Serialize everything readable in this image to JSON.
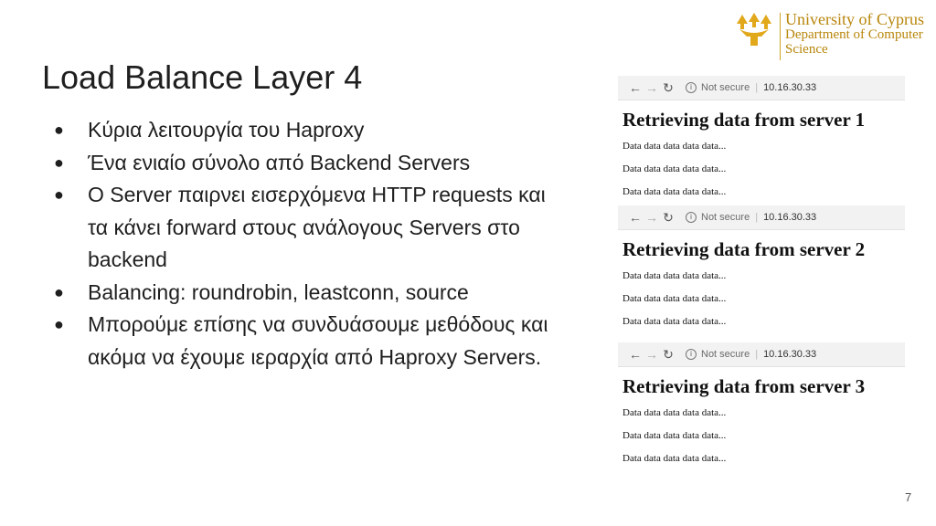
{
  "logo": {
    "line1": "University of Cyprus",
    "line2": "Department of Computer",
    "line3": "Science",
    "mark_icon": "cyprus-tree-icon",
    "color": "#b8860b"
  },
  "slide": {
    "title": "Load Balance Layer 4",
    "bullets": [
      {
        "lines": [
          "Κύρια λειτουργία του Haproxy"
        ]
      },
      {
        "lines": [
          "Ένα ενιαίο σύνολο από Backend Servers"
        ]
      },
      {
        "lines": [
          "O Server παιρνει εισερχόμενα HTTP requests και",
          "τα κάνει forward στους ανάλογους Servers στο",
          "backend"
        ]
      },
      {
        "lines": [
          "Balancing: roundrobin, leastconn, source"
        ]
      },
      {
        "lines": [
          "Μπορούμε επίσης να συνδυάσουμε μεθόδους και",
          "ακόμα να έχουμε ιεραρχία από Haproxy Servers."
        ]
      }
    ],
    "page_number": "7"
  },
  "screenshots": [
    {
      "not_secure": "Not secure",
      "ip": "10.16.30.33",
      "heading": "Retrieving data from server 1",
      "lines": [
        "Data data data data data...",
        "Data data data data data...",
        "Data data data data data..."
      ]
    },
    {
      "not_secure": "Not secure",
      "ip": "10.16.30.33",
      "heading": "Retrieving data from server 2",
      "lines": [
        "Data data data data data...",
        "Data data data data data...",
        "Data data data data data..."
      ]
    },
    {
      "not_secure": "Not secure",
      "ip": "10.16.30.33",
      "heading": "Retrieving data from server 3",
      "lines": [
        "Data data data data data...",
        "Data data data data data...",
        "Data data data data data..."
      ]
    }
  ]
}
